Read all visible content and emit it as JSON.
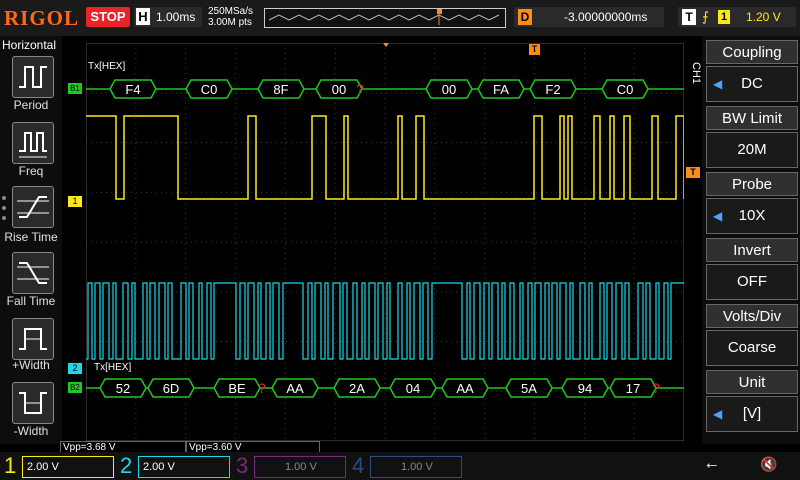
{
  "header": {
    "brand": "RIGOL",
    "run_state": "STOP",
    "horizontal_label": "H",
    "timebase": "1.00ms",
    "sample_rate": "250MSa/s",
    "memory_depth": "3.00M pts",
    "delay_label": "D",
    "delay_value": "-3.00000000ms",
    "trigger_label": "T",
    "trigger_source": "1",
    "trigger_level": "1.20 V"
  },
  "left_menu": {
    "title": "Horizontal",
    "items": [
      {
        "label": "Period"
      },
      {
        "label": "Freq"
      },
      {
        "label": "Rise Time"
      },
      {
        "label": "Fall Time"
      },
      {
        "label": "+Width"
      },
      {
        "label": "-Width"
      }
    ]
  },
  "right_menu": {
    "channel": "CH1",
    "items": [
      {
        "title": "Coupling",
        "value": "DC"
      },
      {
        "title": "BW Limit",
        "value": "20M"
      },
      {
        "title": "Probe",
        "value": "10X"
      },
      {
        "title": "Invert",
        "value": "OFF"
      },
      {
        "title": "Volts/Div",
        "value": "Coarse"
      },
      {
        "title": "Unit",
        "value": "[V]"
      }
    ]
  },
  "decode": {
    "bus1_label": "Tx[HEX]",
    "bus1_marker": "B1",
    "bus1_bytes": [
      "F4",
      "C0",
      "8F",
      "00",
      "?",
      "00",
      "FA",
      "F2",
      "C0"
    ],
    "bus2_label": "Tx[HEX]",
    "bus2_marker": "B2",
    "bus2_bytes": [
      "52",
      "6D",
      "BE",
      "?",
      "AA",
      "2A",
      "04",
      "AA",
      "5A",
      "94",
      "17",
      "?"
    ]
  },
  "markers": {
    "ch1": "1",
    "ch2": "2",
    "trigger": "T"
  },
  "measurements": {
    "vpp1": "Vpp=3.68 V",
    "vpp2": "Vpp=3.60 V"
  },
  "channels": [
    {
      "num": "1",
      "scale": "2.00 V",
      "color": "#ffe81a",
      "active": true
    },
    {
      "num": "2",
      "scale": "2.00 V",
      "color": "#1ad8e8",
      "active": true
    },
    {
      "num": "3",
      "scale": "1.00 V",
      "color": "#d02fd0",
      "active": false
    },
    {
      "num": "4",
      "scale": "1.00 V",
      "color": "#2f6fe8",
      "active": false
    }
  ],
  "colors": {
    "ch1": "#ffe81a",
    "ch2": "#1ad8e8",
    "decode": "#1fc81f",
    "grid": "#3a3a3a",
    "accent": "#ff8c1a"
  }
}
